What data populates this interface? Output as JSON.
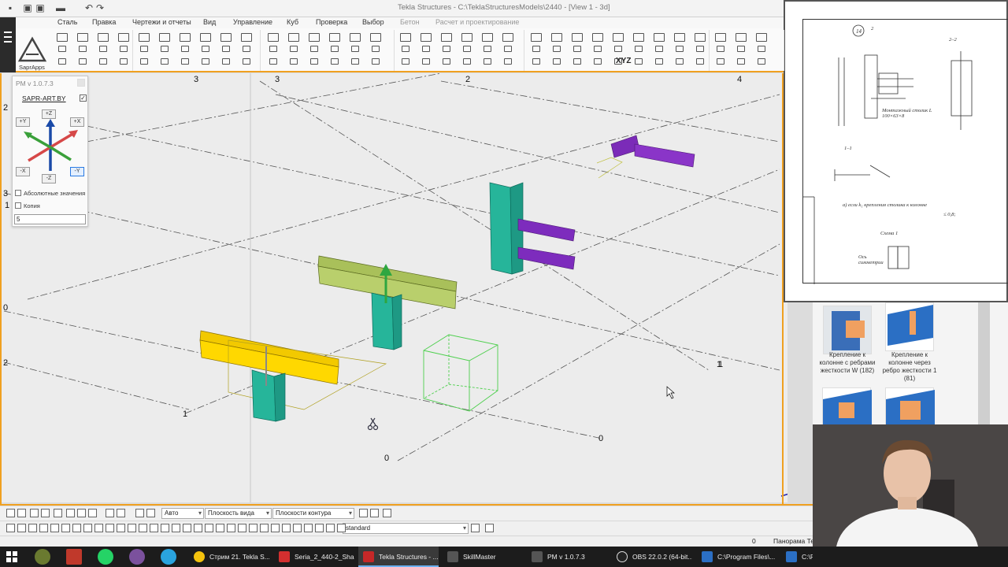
{
  "window": {
    "title": "Tekla Structures - C:\\TeklaStructuresModels\\2440 - [View 1 - 3d]"
  },
  "menu": {
    "items": [
      "Сталь",
      "Правка",
      "Чертежи и отчеты",
      "Вид",
      "Управление",
      "Куб",
      "Проверка",
      "Выбор"
    ],
    "dim_items": [
      "Бетон",
      "Расчет и проектирование"
    ]
  },
  "ribbon": {
    "app_label": "SaprApps",
    "xyz_label": "XYZ"
  },
  "view": {
    "grid_labels": [
      "3",
      "3",
      "2",
      "4",
      "2",
      "1",
      "3",
      "1",
      "0",
      "2",
      "1",
      "1",
      "0",
      "0"
    ]
  },
  "pm_panel": {
    "title": "PM v 1.0.7.3",
    "brand": "SAPR-ART.BY",
    "axes": {
      "plus_y": "+Y",
      "plus_z": "+Z",
      "plus_x": "+X",
      "minus_x": "-X",
      "minus_z": "-Z",
      "minus_y": "-Y"
    },
    "absolute_label": "Абсолютные значения",
    "copy_label": "Копия",
    "value": "5"
  },
  "toolbar_bottom": {
    "select_auto": "Авто",
    "select_plane": "Плоскость вида",
    "select_contour": "Плоскости контура",
    "select_standard": "standard"
  },
  "status": {
    "count": "0",
    "text": "Панорама Текущ"
  },
  "taskbar": {
    "tasks": [
      "Стрим 21. Tekla S...",
      "Seria_2_440-2_Sha...",
      "Tekla Structures - ...",
      "SkillMaster",
      "PM v 1.0.7.3",
      "OBS 22.0.2 (64-bit...",
      "C:\\Program Files\\...",
      "C:\\Pr"
    ]
  },
  "document": {
    "mark": "14",
    "section_a": "2",
    "section_b": "2–2",
    "section_c": "1–1",
    "note_stiffener": "Монтажный столик L 100×63×8",
    "formula_title": "Схема 1",
    "formula_text": "а) если k₁ крепления столика к колонне",
    "formula_tail": "≤ 0,8;",
    "sketch_note": "Ось симметрии"
  },
  "catalog": {
    "items": [
      "Крепление к колонне с ребрами жесткости W (182)",
      "Крепление к колонне через ребро жесткости 1 (81)"
    ]
  }
}
